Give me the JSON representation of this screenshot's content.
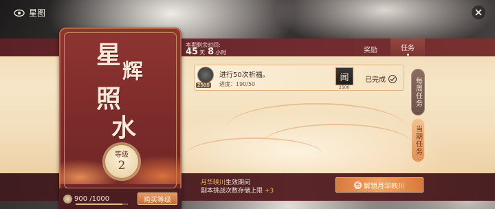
{
  "topbar": {
    "title": "星图",
    "icon": "eye-icon"
  },
  "card": {
    "calligraphy": [
      "星",
      "辉",
      "照",
      "水"
    ],
    "level_label": "等级",
    "level_value": "2",
    "exp_text": "900 /1000",
    "exp_progress": 0.9,
    "buy_level_label": "购买等级",
    "buy_icon": "coin-icon"
  },
  "header": {
    "remaining_label": "本期剩余时间:",
    "remaining_days": "45",
    "days_unit": "天",
    "remaining_hours": "8",
    "hours_unit": "小时",
    "tabs": {
      "rewards": "奖励",
      "tasks": "任务"
    }
  },
  "task": {
    "emblem_count": "2500",
    "title": "进行50次祈福。",
    "progress": "进度：190/50",
    "reward_glyph": "闻",
    "reward_count": "2500",
    "status": "已完成"
  },
  "side_tabs": {
    "weekly": "每周任务",
    "current": "当期任务"
  },
  "footer": {
    "line1_highlight": "月华映川",
    "line1_rest": "生效期间",
    "line2_rest": "副本挑战次数存储上限",
    "line2_highlight": "+3",
    "unlock_label": "解锁月华映川",
    "unlock_glyph": "币"
  }
}
